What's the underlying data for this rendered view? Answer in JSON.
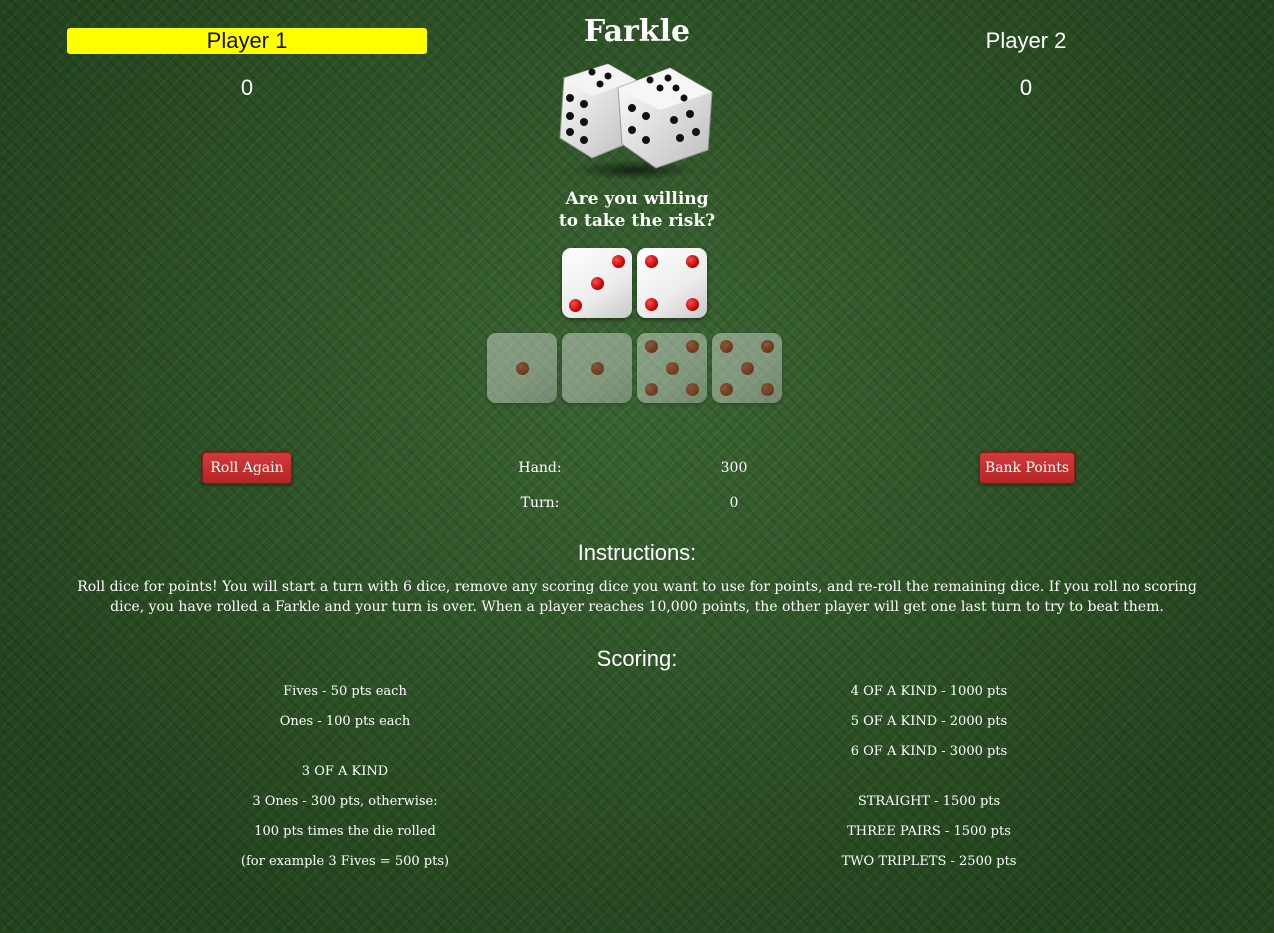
{
  "players": [
    {
      "name": "Player 1",
      "score": "0",
      "active": true
    },
    {
      "name": "Player 2",
      "score": "0",
      "active": false
    }
  ],
  "title": "Farkle",
  "tagline_line1": "Are you willing",
  "tagline_line2": "to take the risk?",
  "rolled_dice": [
    3,
    4
  ],
  "held_dice": [
    1,
    1,
    5,
    5
  ],
  "colors": {
    "active_player_bg": "#ffff00",
    "button": "#c62f2f",
    "felt": "#2e5a26",
    "pip": "#cc0000"
  },
  "controls": {
    "roll_label": "Roll Again",
    "bank_label": "Bank Points"
  },
  "stats": {
    "hand_label": "Hand:",
    "hand_value": "300",
    "turn_label": "Turn:",
    "turn_value": "0"
  },
  "instructions": {
    "title": "Instructions:",
    "text": "Roll dice for points! You will start a turn with 6 dice, remove any scoring dice you want to use for points, and re-roll the remaining dice. If you roll no scoring dice, you have rolled a Farkle and your turn is over. When a player reaches 10,000 points, the other player will get one last turn to try to beat them."
  },
  "scoring": {
    "title": "Scoring:",
    "left": [
      "Fives - 50 pts each",
      "Ones - 100 pts each",
      "3 OF A KIND",
      "3 Ones - 300 pts, otherwise:",
      "100 pts times the die rolled",
      "(for example 3 Fives = 500 pts)"
    ],
    "right": [
      "4 OF A KIND - 1000 pts",
      "5 OF A KIND - 2000 pts",
      "6 OF A KIND - 3000 pts",
      "STRAIGHT - 1500 pts",
      "THREE PAIRS - 1500 pts",
      "TWO TRIPLETS - 2500 pts"
    ]
  }
}
